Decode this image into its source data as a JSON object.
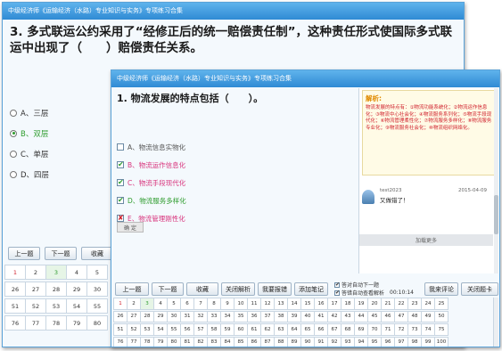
{
  "back_window": {
    "title": "中级经济师《运输经济（水路）专业知识与实务》专项练习合集",
    "question": "3. 多式联运公约采用了“经修正后的统一赔偿责任制”，这种责任形式使国际多式联运中出现了（　　）赔偿责任关系。",
    "options": [
      {
        "label": "A、三层",
        "selected": false
      },
      {
        "label": "B、双层",
        "selected": true
      },
      {
        "label": "C、单层",
        "selected": false
      },
      {
        "label": "D、四层",
        "selected": false
      }
    ],
    "buttons": {
      "prev": "上一题",
      "next": "下一题",
      "fav": "收藏"
    },
    "grid": [
      [
        "1",
        "2",
        "3",
        "4",
        "5"
      ],
      [
        "26",
        "27",
        "28",
        "29",
        "30"
      ],
      [
        "51",
        "52",
        "53",
        "54",
        "55"
      ],
      [
        "76",
        "77",
        "78",
        "79",
        "80"
      ]
    ]
  },
  "front_window": {
    "title": "中级经济师《运输经济（水路）专业知识与实务》专项练习合集",
    "question": "1. 物流发展的特点包括（　　）。",
    "options": [
      {
        "mark": "",
        "label": "A、物流信息实物化"
      },
      {
        "mark": "✔",
        "label": "B、物流运作信息化"
      },
      {
        "mark": "✔",
        "label": "C、物流手段现代化"
      },
      {
        "mark": "✔",
        "label": "D、物流服务多样化"
      },
      {
        "mark": "✘",
        "label": "E、物流管理刚性化"
      }
    ],
    "confirm": "确 定",
    "analysis": {
      "title": "解析:",
      "text": "物流发展的特点有：①物流功能系统化；②物流运作信息化；③物流中心社会化；④物流服务系列化；⑤物流手段现代化；⑥物流管理柔性化；⑦物流服务多样化；⑧物流服务专业化；⑨物流服务社会化；⑩物流组织网络化。"
    },
    "comment": {
      "user": "test2023",
      "date": "2015-04-09",
      "text": "又做错了！"
    },
    "load_more": "加载更多",
    "buttons": {
      "prev": "上一题",
      "next": "下一题",
      "fav": "收藏",
      "close_analysis": "关闭解析",
      "report_error": "我要报错",
      "add_note": "添加笔记",
      "my_comment": "我来评论",
      "close_card": "关闭题卡"
    },
    "toggles": {
      "auto_next": "答对自动下一题",
      "auto_analysis": "答错自动查看解析"
    },
    "timer": "00:10:14",
    "grid": [
      [
        "1",
        "2",
        "3",
        "4",
        "5",
        "6",
        "7",
        "8",
        "9",
        "10",
        "11",
        "12",
        "13",
        "14",
        "15",
        "16",
        "17",
        "18",
        "19",
        "20",
        "21",
        "22",
        "23",
        "24",
        "25"
      ],
      [
        "26",
        "27",
        "28",
        "29",
        "30",
        "31",
        "32",
        "33",
        "34",
        "35",
        "36",
        "37",
        "38",
        "39",
        "40",
        "41",
        "42",
        "43",
        "44",
        "45",
        "46",
        "47",
        "48",
        "49",
        "50"
      ],
      [
        "51",
        "52",
        "53",
        "54",
        "55",
        "56",
        "57",
        "58",
        "59",
        "60",
        "61",
        "62",
        "63",
        "64",
        "65",
        "66",
        "67",
        "68",
        "69",
        "70",
        "71",
        "72",
        "73",
        "74",
        "75"
      ],
      [
        "76",
        "77",
        "78",
        "79",
        "80",
        "81",
        "82",
        "83",
        "84",
        "85",
        "86",
        "87",
        "88",
        "89",
        "90",
        "91",
        "92",
        "93",
        "94",
        "95",
        "96",
        "97",
        "98",
        "99",
        "100"
      ]
    ]
  }
}
